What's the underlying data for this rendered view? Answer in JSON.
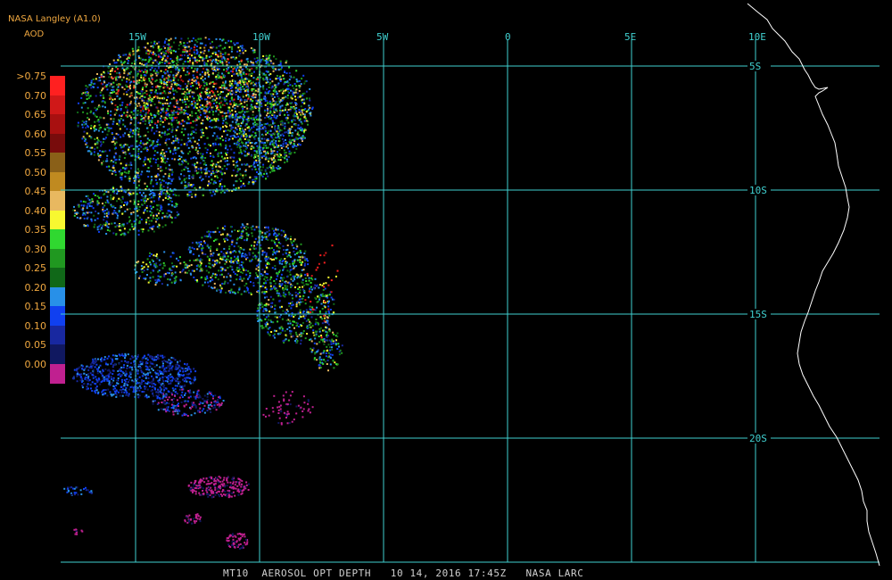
{
  "header": {
    "title": "NASA Langley (A1.0)",
    "subtitle": "AOD"
  },
  "legend": {
    "items": [
      {
        "label": ">0.75",
        "color": "#ff2020"
      },
      {
        "label": "0.70",
        "color": "#d01818"
      },
      {
        "label": "0.65",
        "color": "#a81010"
      },
      {
        "label": "0.60",
        "color": "#780c0c"
      },
      {
        "label": "0.55",
        "color": "#8a6018"
      },
      {
        "label": "0.50",
        "color": "#c08a20"
      },
      {
        "label": "0.45",
        "color": "#e8b860"
      },
      {
        "label": "0.40",
        "color": "#f8f830"
      },
      {
        "label": "0.35",
        "color": "#30d830"
      },
      {
        "label": "0.30",
        "color": "#209820"
      },
      {
        "label": "0.25",
        "color": "#106818"
      },
      {
        "label": "0.20",
        "color": "#2890e8"
      },
      {
        "label": "0.15",
        "color": "#1040f0"
      },
      {
        "label": "0.10",
        "color": "#1828a0"
      },
      {
        "label": "0.05",
        "color": "#101860"
      },
      {
        "label": "0.00",
        "color": "#c02090"
      }
    ]
  },
  "grid": {
    "color": "#40d0d0",
    "lon_labels": [
      "15W",
      "10W",
      "5W",
      "0",
      "5E",
      "10E"
    ],
    "lat_labels": [
      "5S",
      "10S",
      "15S",
      "20S"
    ]
  },
  "footer": {
    "text": "MT10  AEROSOL OPT DEPTH   10 14, 2016 17:45Z   NASA LARC"
  }
}
